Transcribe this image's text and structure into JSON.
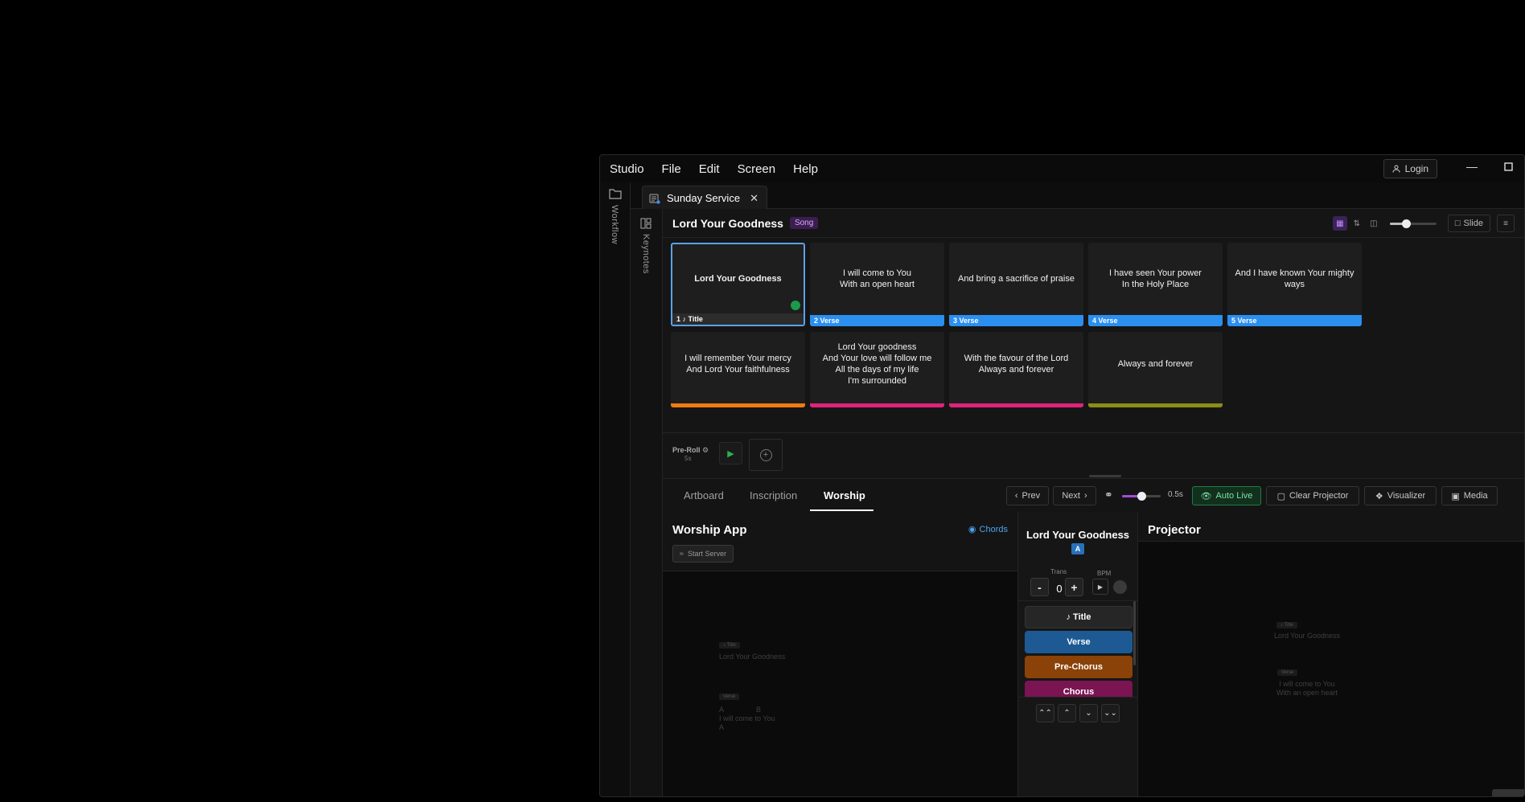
{
  "menu": {
    "studio": "Studio",
    "file": "File",
    "edit": "Edit",
    "screen": "Screen",
    "help": "Help"
  },
  "login_label": "Login",
  "rail": {
    "workflow": "Workflow",
    "keynotes": "Keynotes"
  },
  "doc_tab": {
    "label": "Sunday Service"
  },
  "song": {
    "title": "Lord Your Goodness",
    "badge": "Song",
    "slide_mode": "Slide"
  },
  "slides": [
    {
      "text": "Lord Your Goodness",
      "label": "1 ♪ Title",
      "color": "#2c2c2c",
      "selected": true
    },
    {
      "text": "I will come to You\nWith an open heart",
      "label": "2 Verse",
      "color": "#2b8ff0"
    },
    {
      "text": "And bring a sacrifice of praise",
      "label": "3 Verse",
      "color": "#2b8ff0"
    },
    {
      "text": "I have seen Your power\nIn the Holy Place",
      "label": "4 Verse",
      "color": "#2b8ff0"
    },
    {
      "text": "And I have known Your mighty ways",
      "label": "5 Verse",
      "color": "#2b8ff0"
    },
    {
      "text": "I will remember Your mercy\nAnd Lord Your faithfulness",
      "label": "",
      "color": "#f07a12"
    },
    {
      "text": "Lord Your goodness\nAnd Your love will follow me\nAll the days of my life\nI'm surrounded",
      "label": "",
      "color": "#e0237a"
    },
    {
      "text": "With the favour of the Lord\nAlways and forever",
      "label": "",
      "color": "#e0237a"
    },
    {
      "text": "Always and forever",
      "label": "",
      "color": "#8c8c16"
    }
  ],
  "preroll": {
    "label": "Pre-Roll",
    "duration": "5s"
  },
  "main_tabs": {
    "artboard": "Artboard",
    "inscription": "Inscription",
    "worship": "Worship"
  },
  "controls": {
    "prev": "Prev",
    "next": "Next",
    "speed_value": "0.5s",
    "speed_fraction": 0.5,
    "auto_live": "Auto Live",
    "clear_projector": "Clear Projector",
    "visualizer": "Visualizer",
    "media": "Media"
  },
  "worship_app": {
    "title": "Worship App",
    "chords_label": "Chords",
    "start_server": "Start Server",
    "preview": {
      "tag1": "♪ Title",
      "line1": "Lord Your Goodness",
      "tag2": "Verse",
      "chord_a": "A",
      "chord_b": "B",
      "line2": "I will come to You",
      "chord_c": "A"
    }
  },
  "control_panel": {
    "song_title": "Lord Your Goodness",
    "key": "A",
    "trans_label": "Trans",
    "trans_value": "0",
    "bpm_label": "BPM",
    "sections": [
      {
        "label": "♪ Title",
        "color": "#262626"
      },
      {
        "label": "Verse",
        "color": "#1d5a93"
      },
      {
        "label": "Pre-Chorus",
        "color": "#8a4208"
      },
      {
        "label": "Chorus",
        "color": "#7a1452"
      }
    ]
  },
  "projector": {
    "title": "Projector",
    "preview": {
      "tag1": "♪ Title",
      "line1": "Lord Your Goodness",
      "tag2": "Verse",
      "line2": "I will come to You",
      "line3": "With an open heart"
    }
  },
  "zoom_fraction": 0.35
}
